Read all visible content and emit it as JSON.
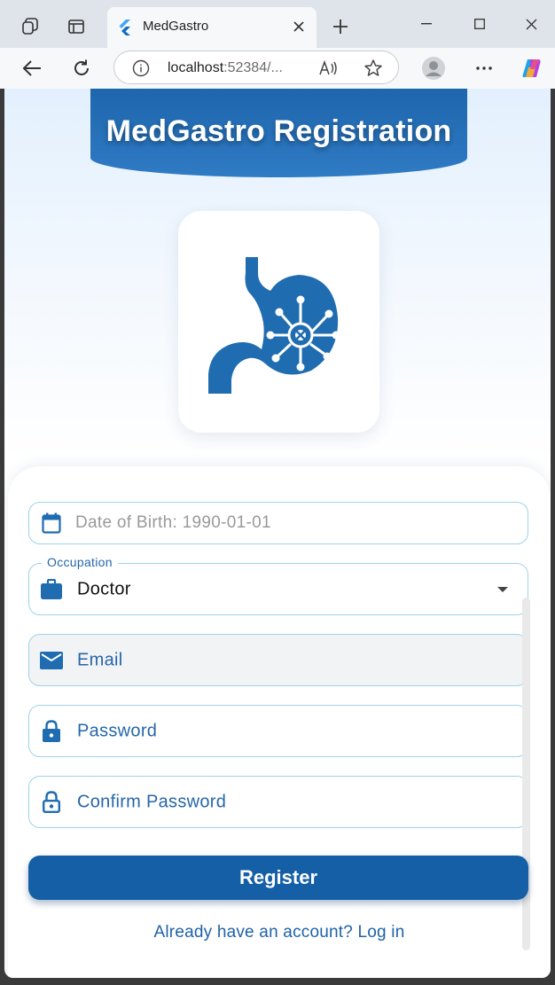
{
  "browser": {
    "tab_title": "MedGastro",
    "url_host": "localhost",
    "url_rest": ":52384/..."
  },
  "app": {
    "title": "MedGastro Registration",
    "logo_icon": "stomach-circuit-icon",
    "accent": "#155fa7",
    "banner_color": "#1e66ad",
    "field_border": "#9fd2ea"
  },
  "form": {
    "dob_placeholder": "Date of Birth: 1990-01-01",
    "occupation_label": "Occupation",
    "occupation_value": "Doctor",
    "email_label": "Email",
    "password_label": "Password",
    "confirm_password_label": "Confirm Password",
    "register_label": "Register",
    "login_link": "Already have an account? Log in"
  },
  "icons": {
    "dob": "calendar-icon",
    "occupation": "briefcase-icon",
    "email": "mail-icon",
    "password": "lock-icon",
    "confirm_password": "lock-outline-icon"
  }
}
